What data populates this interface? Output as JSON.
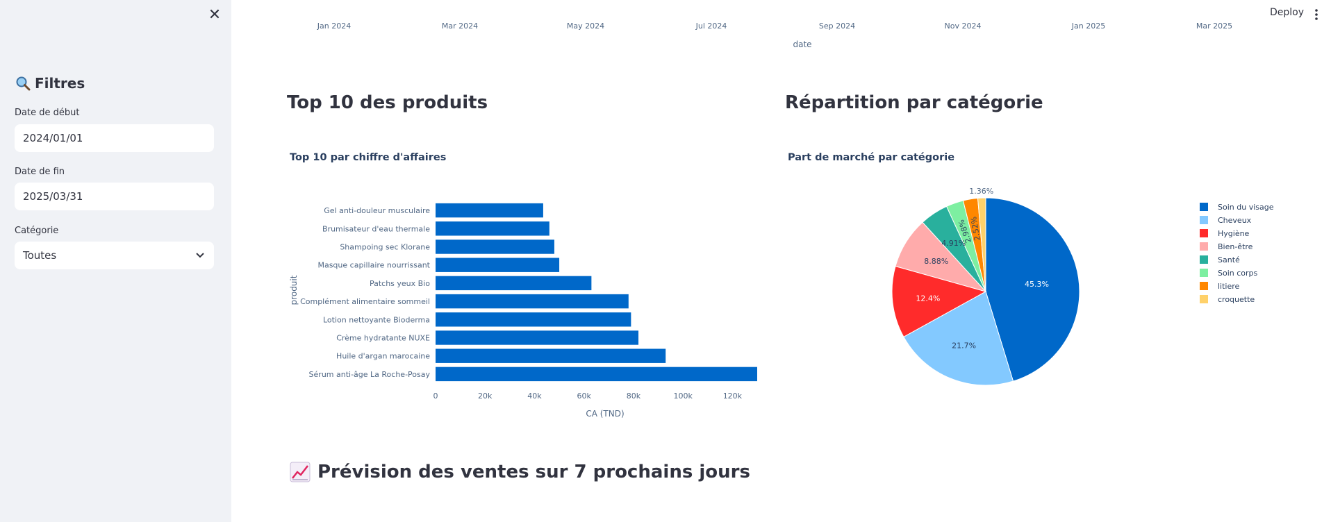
{
  "sidebar": {
    "filters_title": "Filtres",
    "start_label": "Date de début",
    "start_value": "2024/01/01",
    "end_label": "Date de fin",
    "end_value": "2025/03/31",
    "category_label": "Catégorie",
    "category_value": "Toutes"
  },
  "header": {
    "deploy_label": "Deploy"
  },
  "timeline_axis": {
    "ticks": [
      "Jan 2024",
      "Mar 2024",
      "May 2024",
      "Jul 2024",
      "Sep 2024",
      "Nov 2024",
      "Jan 2025",
      "Mar 2025"
    ],
    "xlabel": "date"
  },
  "sections": {
    "top_products_heading": "Top 10 des produits",
    "category_heading": "Répartition par catégorie",
    "forecast_heading": "Prévision des ventes sur 7 prochains jours"
  },
  "chart_data": [
    {
      "type": "bar",
      "orientation": "horizontal",
      "title": "Top 10 par chiffre d'affaires",
      "xlabel": "CA (TND)",
      "ylabel": "produit",
      "categories": [
        "Sérum anti-âge La Roche-Posay",
        "Huile d'argan marocaine",
        "Crème hydratante NUXE",
        "Lotion nettoyante Bioderma",
        "Complément alimentaire sommeil",
        "Patchs yeux Bio",
        "Masque capillaire nourrissant",
        "Shampoing sec Klorane",
        "Brumisateur d'eau thermale",
        "Gel anti-douleur musculaire"
      ],
      "values": [
        130000,
        93000,
        82000,
        79000,
        78000,
        63000,
        50000,
        48000,
        46000,
        43500
      ],
      "xlim": [
        0,
        130000
      ],
      "xticks": [
        0,
        20000,
        40000,
        60000,
        80000,
        100000,
        120000
      ],
      "xtick_labels": [
        "0",
        "20k",
        "40k",
        "60k",
        "80k",
        "100k",
        "120k"
      ],
      "color": "#0068c9",
      "grid": false
    },
    {
      "type": "pie",
      "title": "Part de marché par catégorie",
      "labels": [
        "Soin du visage",
        "Cheveux",
        "Hygiène",
        "Bien-être",
        "Santé",
        "Soin corps",
        "litiere",
        "croquette"
      ],
      "values": [
        45.3,
        21.7,
        12.4,
        8.88,
        4.91,
        2.98,
        2.52,
        1.36
      ],
      "value_labels": [
        "45.3%",
        "21.7%",
        "12.4%",
        "8.88%",
        "4.91%",
        "2.98%",
        "2.52%",
        "1.36%"
      ],
      "colors": [
        "#0068c9",
        "#83c9ff",
        "#ff2b2b",
        "#ffabab",
        "#29b09d",
        "#7defa1",
        "#ff8700",
        "#ffd16a"
      ],
      "legend": "right"
    }
  ]
}
